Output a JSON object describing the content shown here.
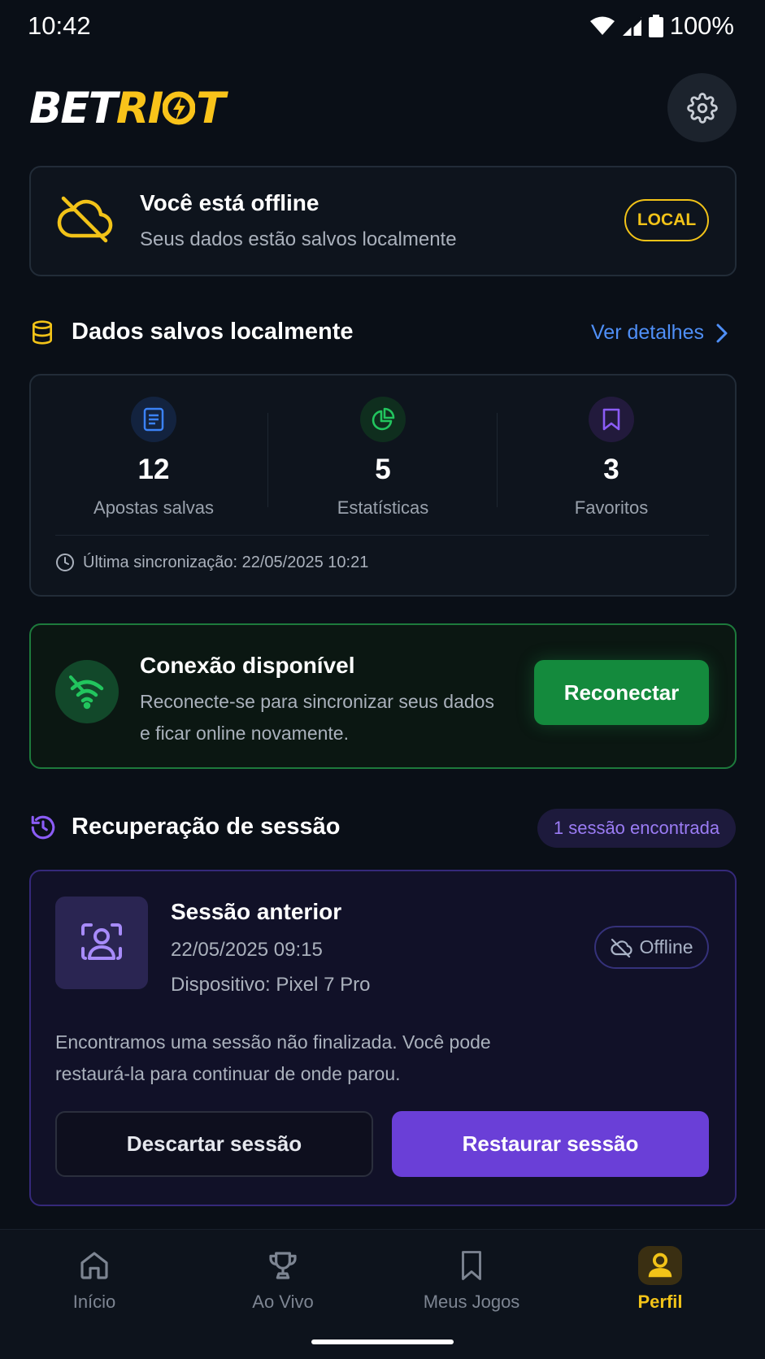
{
  "status_bar": {
    "time": "10:42",
    "battery": "100%"
  },
  "header": {
    "logo_part1": "BET",
    "logo_part2": "RI",
    "logo_part3": "T",
    "settings_icon": "gear-icon"
  },
  "offline_banner": {
    "title": "Você está offline",
    "subtitle": "Seus dados estão salvos localmente",
    "badge": "LOCAL",
    "icon": "cloud-off-icon",
    "accent": "#f2c318"
  },
  "local_data": {
    "title": "Dados salvos localmente",
    "link": "Ver detalhes",
    "stats": [
      {
        "value": "12",
        "label": "Apostas salvas",
        "icon": "document-icon",
        "color": "#3b82f6"
      },
      {
        "value": "5",
        "label": "Estatísticas",
        "icon": "pie-chart-icon",
        "color": "#22c55e"
      },
      {
        "value": "3",
        "label": "Favoritos",
        "icon": "bookmark-icon",
        "color": "#8b5cf6"
      }
    ],
    "last_sync": "Última sincronização: 22/05/2025 10:21"
  },
  "connection": {
    "title": "Conexão disponível",
    "description": "Reconecte-se para sincronizar seus dados e ficar online novamente.",
    "button": "Reconectar",
    "icon": "wifi-icon",
    "accent": "#148a3d"
  },
  "session": {
    "title": "Recuperação de sessão",
    "badge": "1 sessão encontrada",
    "card": {
      "name": "Sessão anterior",
      "date": "22/05/2025 09:15",
      "device": "Dispositivo: Pixel 7 Pro",
      "status": "Offline",
      "description": "Encontramos uma sessão não finalizada. Você pode restaurá-la para continuar de onde parou.",
      "discard_label": "Descartar sessão",
      "restore_label": "Restaurar sessão"
    },
    "accent": "#6a3fd7"
  },
  "bottom_nav": {
    "items": [
      {
        "label": "Início",
        "icon": "home-icon"
      },
      {
        "label": "Ao Vivo",
        "icon": "trophy-icon"
      },
      {
        "label": "Meus Jogos",
        "icon": "bookmark-icon"
      },
      {
        "label": "Perfil",
        "icon": "user-icon",
        "active": true
      }
    ]
  }
}
